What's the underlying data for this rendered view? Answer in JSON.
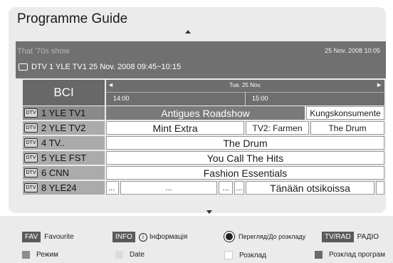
{
  "header": {
    "title": "Programme Guide"
  },
  "info": {
    "show_title": "That '70s show",
    "datetime": "25 Nov. 2008 10:05",
    "channel_line": "DTV  1 YLE TV1 25 Nov. 2008 09:45~10:15"
  },
  "grid": {
    "logo": "BCI",
    "timebar": {
      "date": "Tue. 25 Nov.",
      "left_arrow": "◄",
      "right_arrow": "►",
      "time1": "14:00",
      "time2": "15:00"
    },
    "rows": [
      {
        "channel": "1  YLE TV1",
        "programs": [
          "Antigues Roadshow",
          "Kungskonsumente"
        ]
      },
      {
        "channel": "2  YLE TV2",
        "programs": [
          "Mint Extra",
          "TV2: Farmen",
          "The Drum"
        ]
      },
      {
        "channel": "4  TV..",
        "programs": [
          "The Drum"
        ]
      },
      {
        "channel": "5  YLE FST",
        "programs": [
          "You Call The Hits"
        ]
      },
      {
        "channel": "6  CNN",
        "programs": [
          "Fashion Essentials"
        ]
      },
      {
        "channel": "8  YLE24",
        "programs": [
          "...",
          "...",
          "...",
          "...",
          "Tänään otsikoissa"
        ]
      }
    ]
  },
  "legend": {
    "fav_key": "FAV",
    "fav_label": "Favourite",
    "info_key": "INFO",
    "info_icon": "i",
    "info_label": "Інформація",
    "ok_label": "Перегляд/До розкладу",
    "tvrad_key": "TV/RAD",
    "tvrad_label": "РАДІО",
    "red_label": "Режим",
    "green_label": "Date",
    "yellow_label": "Розклад",
    "blue_label": "Розклад програм"
  },
  "colors": {
    "red": "#8c8c8c",
    "green": "#dcdcdc",
    "yellow": "#ffffff",
    "blue": "#6a6a6a"
  }
}
